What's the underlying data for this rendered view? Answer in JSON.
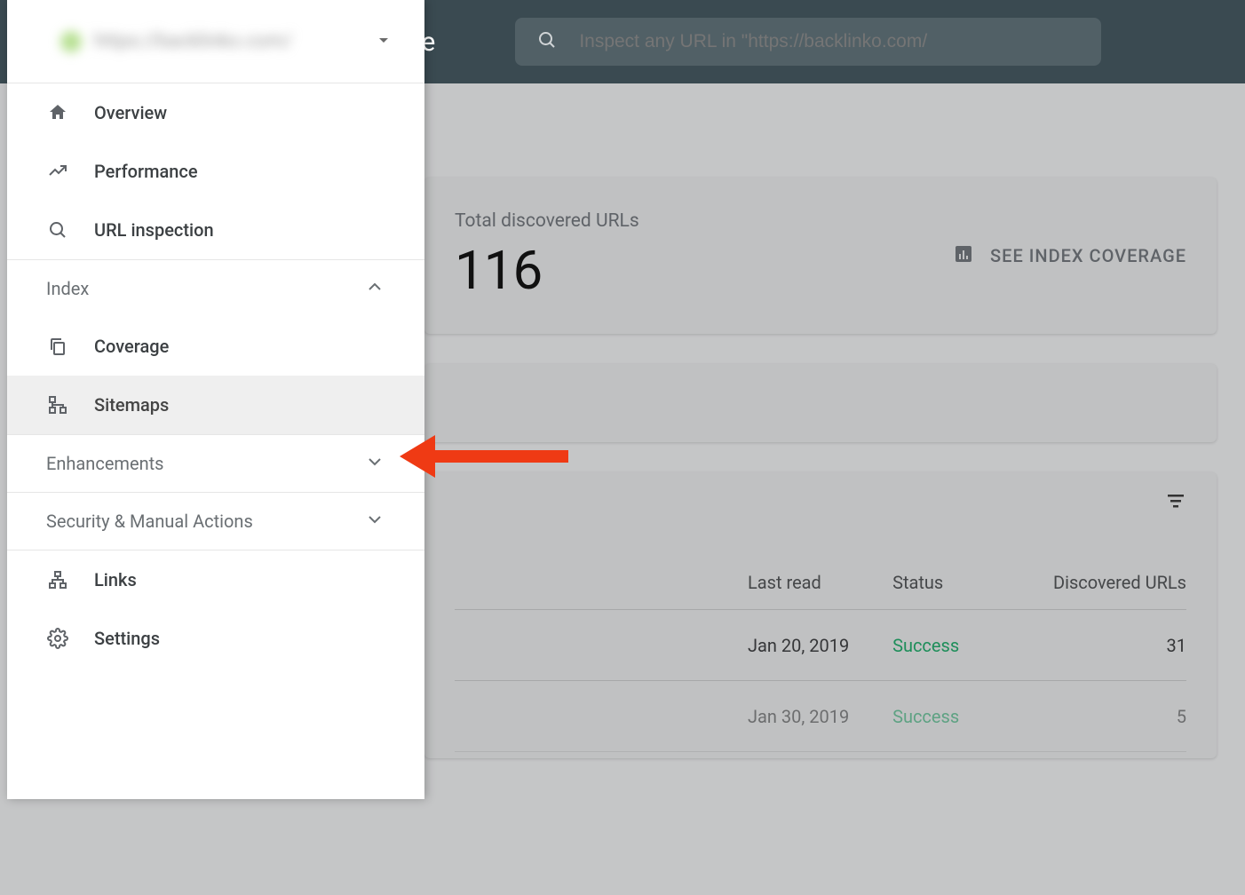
{
  "header": {
    "brand_fragment": "ole",
    "search_placeholder": "Inspect any URL in \"https://backlinko.com/"
  },
  "sidebar": {
    "property_blur_text": "https://backlinko.com/",
    "overview": "Overview",
    "performance": "Performance",
    "url_inspection": "URL inspection",
    "section_index": "Index",
    "coverage": "Coverage",
    "sitemaps": "Sitemaps",
    "section_enhancements": "Enhancements",
    "section_security": "Security & Manual Actions",
    "links": "Links",
    "settings": "Settings"
  },
  "main": {
    "discovered_label": "Total discovered URLs",
    "discovered_value": "116",
    "see_coverage": "SEE INDEX COVERAGE",
    "table": {
      "headers": {
        "last_read": "Last read",
        "status": "Status",
        "discovered": "Discovered URLs"
      },
      "rows": [
        {
          "last_read": "Jan 20, 2019",
          "status": "Success",
          "discovered": "31"
        },
        {
          "last_read": "Jan 30, 2019",
          "status": "Success",
          "discovered": "5"
        }
      ]
    }
  }
}
